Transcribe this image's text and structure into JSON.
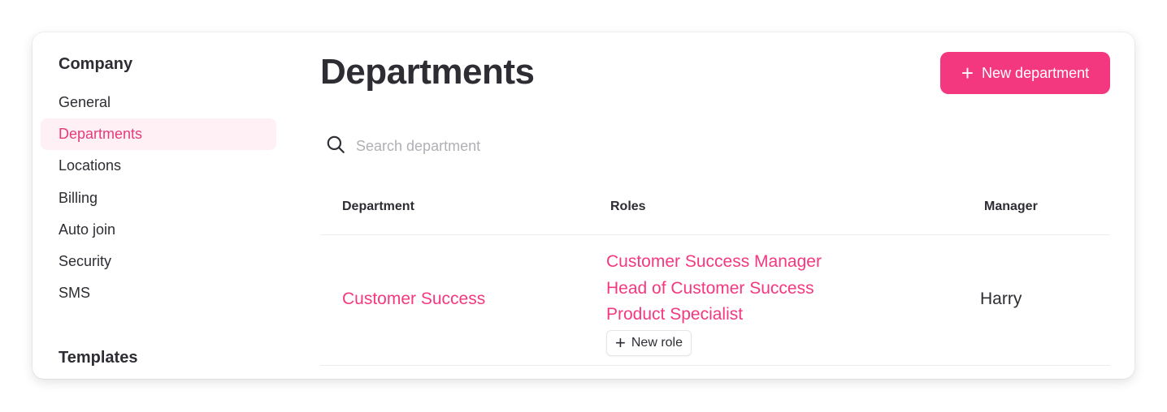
{
  "sidebar": {
    "sections": [
      {
        "title": "Company",
        "items": [
          {
            "label": "General",
            "active": false
          },
          {
            "label": "Departments",
            "active": true
          },
          {
            "label": "Locations",
            "active": false
          },
          {
            "label": "Billing",
            "active": false
          },
          {
            "label": "Auto join",
            "active": false
          },
          {
            "label": "Security",
            "active": false
          },
          {
            "label": "SMS",
            "active": false
          }
        ]
      },
      {
        "title": "Templates",
        "items": []
      }
    ]
  },
  "main": {
    "title": "Departments",
    "new_department_label": "New department",
    "new_department_icon": "plus-icon",
    "search": {
      "icon": "search-icon",
      "placeholder": "Search department",
      "value": ""
    },
    "table": {
      "columns": [
        "Department",
        "Roles",
        "Manager"
      ],
      "rows": [
        {
          "department": "Customer Success",
          "roles": [
            "Customer Success Manager",
            "Head of Customer Success",
            "Product Specialist"
          ],
          "new_role_label": "New role",
          "manager": "Harry"
        }
      ]
    }
  },
  "colors": {
    "accent": "#f4387f",
    "active_nav_bg": "#fef0f4",
    "active_nav_text": "#e43c7a",
    "text": "#2d2d33",
    "placeholder": "#b0b0b5"
  }
}
